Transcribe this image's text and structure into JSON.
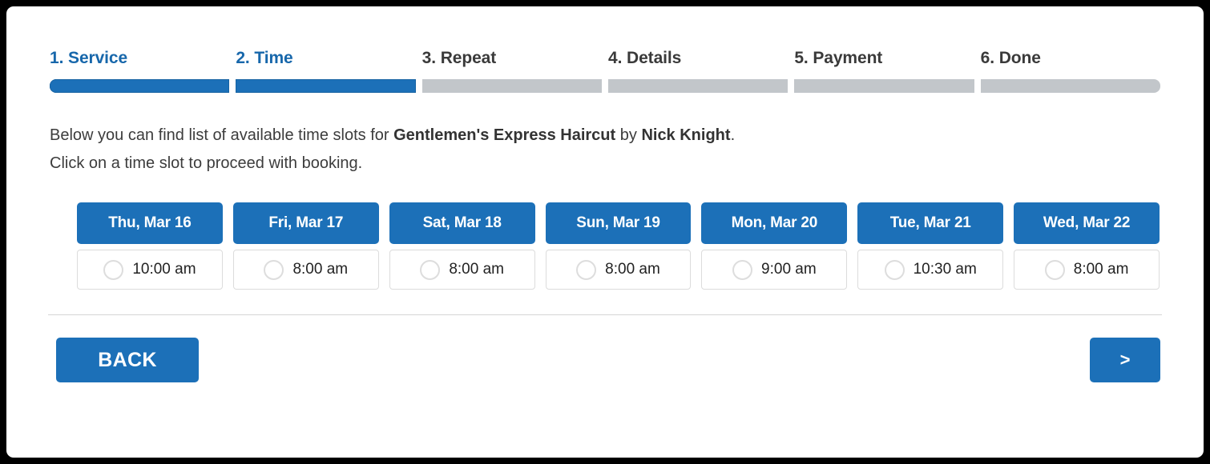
{
  "theme": {
    "accent": "#1c70b8",
    "inactive_bar": "#c2c6ca",
    "text": "#3c3c3c",
    "frame": "#000000"
  },
  "stepper": {
    "steps": [
      {
        "label": "1. Service",
        "active": true
      },
      {
        "label": "2. Time",
        "active": true
      },
      {
        "label": "3. Repeat",
        "active": false
      },
      {
        "label": "4. Details",
        "active": false
      },
      {
        "label": "5. Payment",
        "active": false
      },
      {
        "label": "6. Done",
        "active": false
      }
    ]
  },
  "description": {
    "line1_prefix": "Below you can find list of available time slots for ",
    "service_name": "Gentlemen's Express Haircut",
    "line1_mid": " by ",
    "provider_name": "Nick Knight",
    "line1_suffix": ".",
    "line2": "Click on a time slot to proceed with booking."
  },
  "slots": {
    "columns": [
      {
        "day": "Thu, Mar 16",
        "time": "10:00 am",
        "selected": false
      },
      {
        "day": "Fri, Mar 17",
        "time": "8:00 am",
        "selected": false
      },
      {
        "day": "Sat, Mar 18",
        "time": "8:00 am",
        "selected": false
      },
      {
        "day": "Sun, Mar 19",
        "time": "8:00 am",
        "selected": false
      },
      {
        "day": "Mon, Mar 20",
        "time": "9:00 am",
        "selected": false
      },
      {
        "day": "Tue, Mar 21",
        "time": "10:30 am",
        "selected": false
      },
      {
        "day": "Wed, Mar 22",
        "time": "8:00 am",
        "selected": false
      }
    ]
  },
  "footer": {
    "back_label": "BACK",
    "next_label": ">"
  }
}
